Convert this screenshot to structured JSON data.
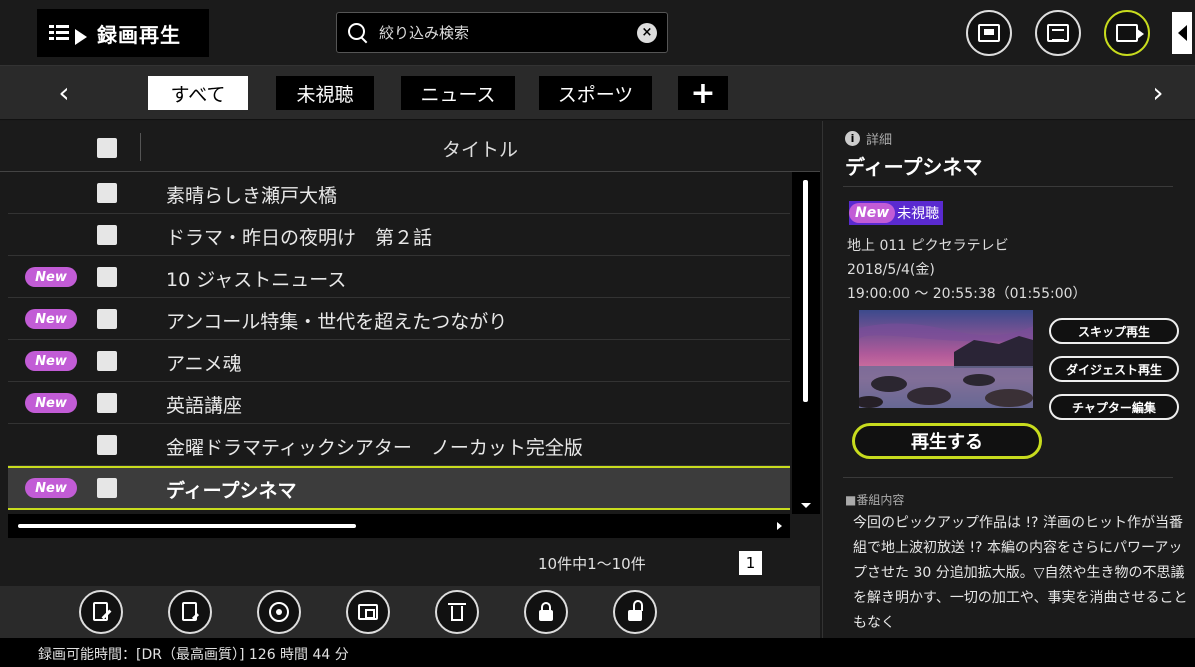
{
  "header": {
    "app_title": "録画再生",
    "search": {
      "placeholder": "絞り込み検索",
      "value": ""
    }
  },
  "tabs": [
    {
      "label": "すべて",
      "active": true
    },
    {
      "label": "未視聴",
      "active": false
    },
    {
      "label": "ニュース",
      "active": false
    },
    {
      "label": "スポーツ",
      "active": false
    }
  ],
  "list": {
    "column_title": "タイトル",
    "new_badge": "New",
    "rows": [
      {
        "title": "素晴らしき瀬戸大橋",
        "new": false,
        "selected": false
      },
      {
        "title": "ドラマ・昨日の夜明け　第２話",
        "new": false,
        "selected": false
      },
      {
        "title": "10 ジャストニュース",
        "new": true,
        "selected": false
      },
      {
        "title": "アンコール特集・世代を超えたつながり",
        "new": true,
        "selected": false
      },
      {
        "title": "アニメ魂",
        "new": true,
        "selected": false
      },
      {
        "title": "英語講座",
        "new": true,
        "selected": false
      },
      {
        "title": "金曜ドラマティックシアター　ノーカット完全版",
        "new": false,
        "selected": false
      },
      {
        "title": "ディープシネマ",
        "new": true,
        "selected": true
      }
    ]
  },
  "pager": {
    "count": "10件中1〜10件",
    "page": "1"
  },
  "status_bar": "録画可能時間：[DR（最高画質）] 126 時間 44 分",
  "detail": {
    "label": "詳細",
    "title": "ディープシネマ",
    "new_badge": "New",
    "status": "未視聴",
    "channel": "地上 011 ピクセラテレビ",
    "date": "2018/5/4(金)",
    "time": "19:00:00 〜 20:55:38（01:55:00）",
    "buttons": {
      "skip": "スキップ再生",
      "digest": "ダイジェスト再生",
      "chapter": "チャプター編集",
      "play": "再生する"
    },
    "content_label": "■番組内容",
    "description": "今回のピックアップ作品は !? 洋画のヒット作が当番組で地上波初放送 !? 本編の内容をさらにパワーアップさせた 30 分追加拡大版。▽自然や生き物の不思議を解き明かす、一切の加工や、事実を消曲させることもなく"
  },
  "colors": {
    "accent": "#c8dc1e",
    "new_badge": "#c25cd6",
    "unwatched_bg": "#5a2ad0"
  },
  "icons": {
    "header": [
      "live-tv-icon",
      "program-guide-icon",
      "recorded-play-icon"
    ],
    "toolbar": [
      "edit-title-icon",
      "detail-edit-icon",
      "dubbing-disc-icon",
      "convert-icon",
      "delete-icon",
      "lock-icon",
      "unlock-icon"
    ]
  }
}
